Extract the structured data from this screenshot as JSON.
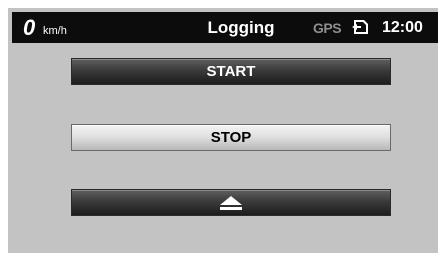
{
  "status_bar": {
    "speed_value": "0",
    "speed_unit": "km/h",
    "title": "Logging",
    "gps_label": "GPS",
    "card_icon": "memory-card-icon",
    "time": "12:00"
  },
  "buttons": {
    "start_label": "START",
    "stop_label": "STOP",
    "eject_icon": "eject-icon"
  },
  "colors": {
    "background": "#c3c3c3",
    "status_bar": "#0c0c0c",
    "gps_inactive": "#8d8d8d",
    "button_dark": "#3b3b3b",
    "button_light": "#dedede"
  }
}
